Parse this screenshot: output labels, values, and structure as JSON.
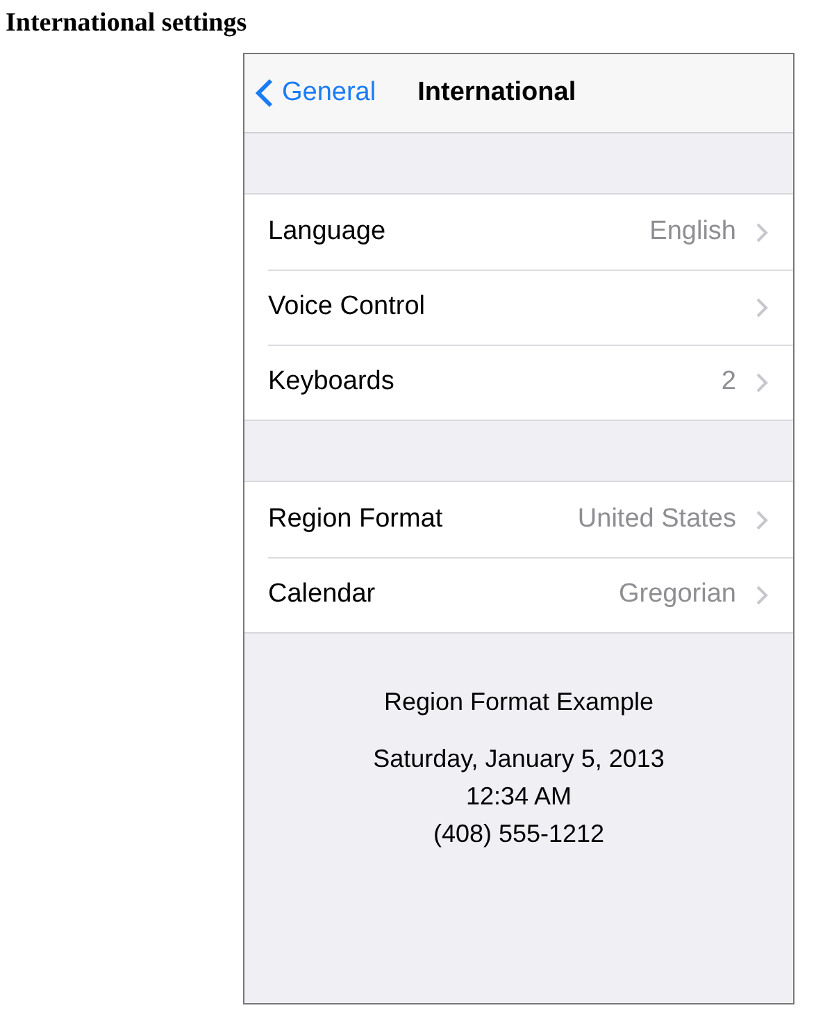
{
  "heading": "International settings",
  "nav": {
    "back": "General",
    "title": "International"
  },
  "groups": [
    {
      "rows": [
        {
          "label": "Language",
          "value": "English"
        },
        {
          "label": "Voice Control"
        },
        {
          "label": "Keyboards",
          "value": "2"
        }
      ]
    },
    {
      "rows": [
        {
          "label": "Region Format",
          "value": "United States"
        },
        {
          "label": "Calendar",
          "value": "Gregorian"
        }
      ]
    }
  ],
  "example": {
    "title": "Region Format Example",
    "lines": [
      "Saturday, January 5, 2013",
      "12:34 AM",
      "(408) 555-1212"
    ]
  }
}
